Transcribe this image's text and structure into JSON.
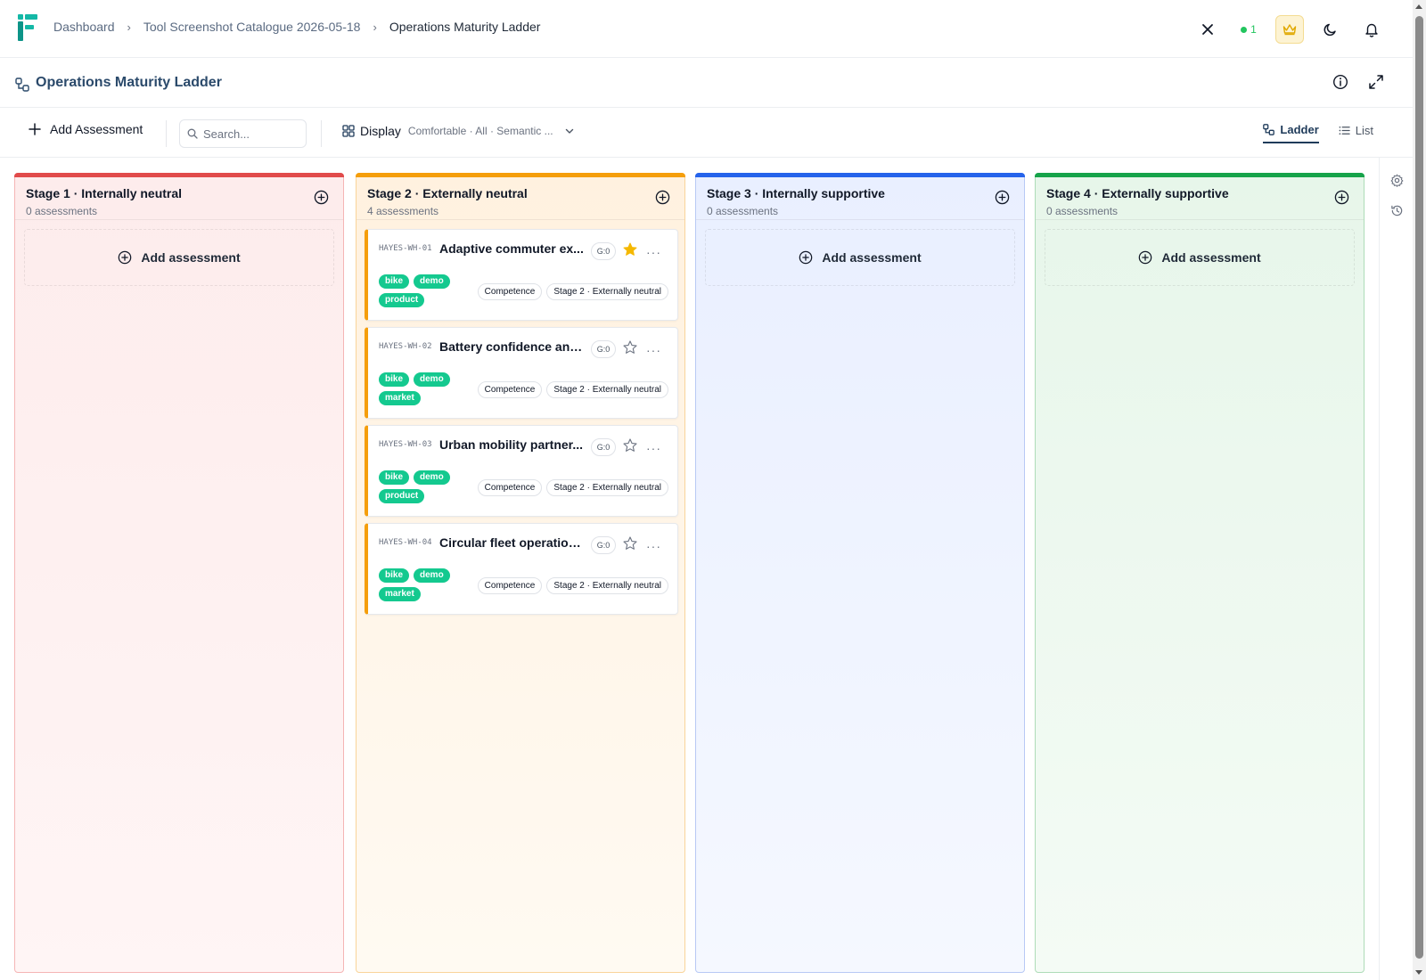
{
  "breadcrumb": {
    "items": [
      "Dashboard",
      "Tool Screenshot Catalogue 2026-05-18"
    ],
    "current": "Operations Maturity Ladder"
  },
  "topbar": {
    "online_count": "1"
  },
  "page": {
    "title": "Operations Maturity Ladder"
  },
  "toolbar": {
    "add_label": "Add Assessment",
    "search_placeholder": "Search...",
    "display_label": "Display",
    "display_summary": "Comfortable · All · Semantic ...",
    "views": [
      "Ladder",
      "List"
    ],
    "active_view": "Ladder"
  },
  "columns": [
    {
      "title": "Stage 1 · Internally neutral",
      "count": "0 assessments",
      "accent": "#e14b4b",
      "empty_label": "Add assessment"
    },
    {
      "title": "Stage 2 · Externally neutral",
      "count": "4 assessments",
      "accent": "#f59e0b",
      "empty_label": ""
    },
    {
      "title": "Stage 3 · Internally supportive",
      "count": "0 assessments",
      "accent": "#2563eb",
      "empty_label": "Add assessment"
    },
    {
      "title": "Stage 4 · Externally supportive",
      "count": "0 assessments",
      "accent": "#16a34a",
      "empty_label": "Add assessment"
    }
  ],
  "cards": [
    {
      "code": "HAYES-WH-01",
      "title": "Adaptive commuter ex...",
      "badge": "G:0",
      "starred": true,
      "tags": [
        "bike",
        "demo",
        "product"
      ],
      "chips": [
        "Competence",
        "Stage 2 · Externally neutral"
      ]
    },
    {
      "code": "HAYES-WH-02",
      "title": "Battery confidence and...",
      "badge": "G:0",
      "starred": false,
      "tags": [
        "bike",
        "demo",
        "market"
      ],
      "chips": [
        "Competence",
        "Stage 2 · Externally neutral"
      ]
    },
    {
      "code": "HAYES-WH-03",
      "title": "Urban mobility partner...",
      "badge": "G:0",
      "starred": false,
      "tags": [
        "bike",
        "demo",
        "product"
      ],
      "chips": [
        "Competence",
        "Stage 2 · Externally neutral"
      ]
    },
    {
      "code": "HAYES-WH-04",
      "title": "Circular fleet operation...",
      "badge": "G:0",
      "starred": false,
      "tags": [
        "bike",
        "demo",
        "market"
      ],
      "chips": [
        "Competence",
        "Stage 2 · Externally neutral"
      ]
    }
  ],
  "colors": {
    "brand": "#14b8a6",
    "tag": "#14c98f",
    "star_active": "#f5b800",
    "online": "#22c55e"
  },
  "icons": [
    "logo-icon",
    "chevron-right-icon",
    "close-icon",
    "crown-icon",
    "moon-icon",
    "bell-icon",
    "workflow-icon",
    "info-icon",
    "expand-icon",
    "plus-icon",
    "search-icon",
    "grid-icon",
    "chevron-down-icon",
    "list-icon",
    "settings-icon",
    "history-icon",
    "plus-circle-icon",
    "star-icon",
    "more-icon"
  ]
}
